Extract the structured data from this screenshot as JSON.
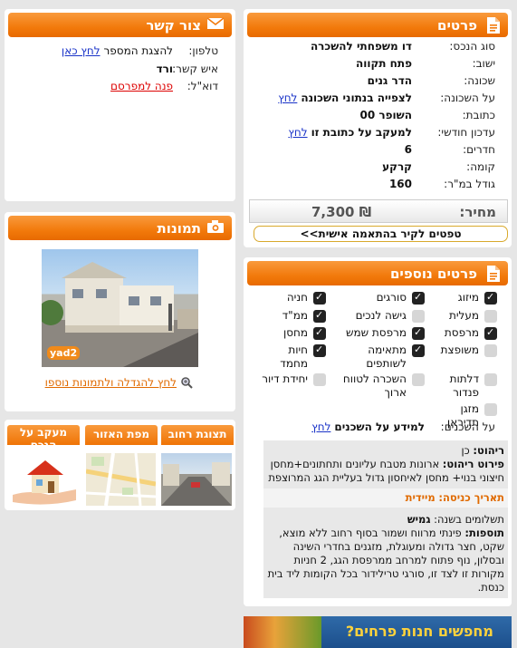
{
  "contact": {
    "title": "צור קשר",
    "phone_label": "טלפון:",
    "phone_text": "להצגת המספר",
    "phone_link": "לחץ כאן",
    "person_label": "איש קשר:",
    "person_value": "ורד",
    "email_label": "דוא\"ל:",
    "email_link": "פנה למפרסם"
  },
  "details": {
    "title": "פרטים",
    "rows": [
      {
        "label": "סוג הנכס:",
        "value": "דו משפחתי להשכרה",
        "link": ""
      },
      {
        "label": "ישוב:",
        "value": "פתח תקווה",
        "link": ""
      },
      {
        "label": "שכונה:",
        "value": "הדר גנים",
        "link": ""
      },
      {
        "label": "על השכונה:",
        "value": "לצפייה בנתוני השכונה",
        "link": "לחץ"
      },
      {
        "label": "כתובת:",
        "value": "השופר 00",
        "link": ""
      },
      {
        "label": "עדכון חודשי:",
        "value": "למעקב על כתובת זו",
        "link": "לחץ"
      },
      {
        "label": "חדרים:",
        "value": "6",
        "link": ""
      },
      {
        "label": "קומה:",
        "value": "קרקע",
        "link": ""
      },
      {
        "label": "גודל במ\"ר:",
        "value": "160",
        "link": ""
      }
    ],
    "price_label": "מחיר:",
    "price_value": "7,300 ₪",
    "match_button": "טפטים לקיר בהתאמה אישית>>"
  },
  "photos": {
    "title": "תמונות",
    "watermark": "yad2",
    "more_link": "לחץ להגדלה ולתמונות נוספו"
  },
  "tabs": [
    "תצוגת רחוב",
    "מפת האזור",
    "מעקב על הנכס"
  ],
  "more_details": {
    "title": "פרטים נוספים",
    "options": [
      {
        "label": "מיזוג",
        "on": true
      },
      {
        "label": "סורגים",
        "on": true
      },
      {
        "label": "חניה",
        "on": true
      },
      {
        "label": "מעלית",
        "on": false
      },
      {
        "label": "גישה לנכים",
        "on": false
      },
      {
        "label": "ממ\"ד",
        "on": true
      },
      {
        "label": "מרפסת",
        "on": true
      },
      {
        "label": "מרפסת שמש",
        "on": true
      },
      {
        "label": "מחסן",
        "on": true
      },
      {
        "label": "משופצת",
        "on": false
      },
      {
        "label": "מתאימה לשותפים",
        "on": true
      },
      {
        "label": "חיות מחמד",
        "on": true
      },
      {
        "label": "דלתות פנדור",
        "on": false
      },
      {
        "label": "השכרה לטווח ארוך",
        "on": false
      },
      {
        "label": "יחידת דיור",
        "on": false
      },
      {
        "label": "מזגן תדיראן",
        "on": false
      }
    ],
    "tenants_label": "על השכנים:",
    "tenants_value": "למידע על השכנים",
    "tenants_link": "לחץ"
  },
  "description": {
    "furniture_label": "ריהוט:",
    "furniture_value": "כן",
    "furniture_detail_label": "פירוט ריהוט:",
    "furniture_detail_value": "ארונות מטבח עליונים ותחתונים+מחסן חיצוני בנוי+ מחסן לאיחסון גדול בעליית הגג המרוצפת",
    "entry_label": "תאריך כניסה:",
    "entry_value": "מיידית",
    "payments_label": "תשלומים בשנה:",
    "payments_value": "גמיש",
    "extras_label": "תוספות:",
    "extras_value": "פינתי מרווח ושמור בסוף רחוב ללא מוצא, שקט, חצר גדולה ומעוגלת, מזגנים בחדרי השינה ובסלון, נוף פתוח למרחב ממרפסת הגג, 2 חניות מקורות זו לצד זו, סורגי טרילידור בכל הקומות ליד בית כנסת."
  },
  "banner": {
    "text": "מחפשים חנות פרחים?"
  }
}
